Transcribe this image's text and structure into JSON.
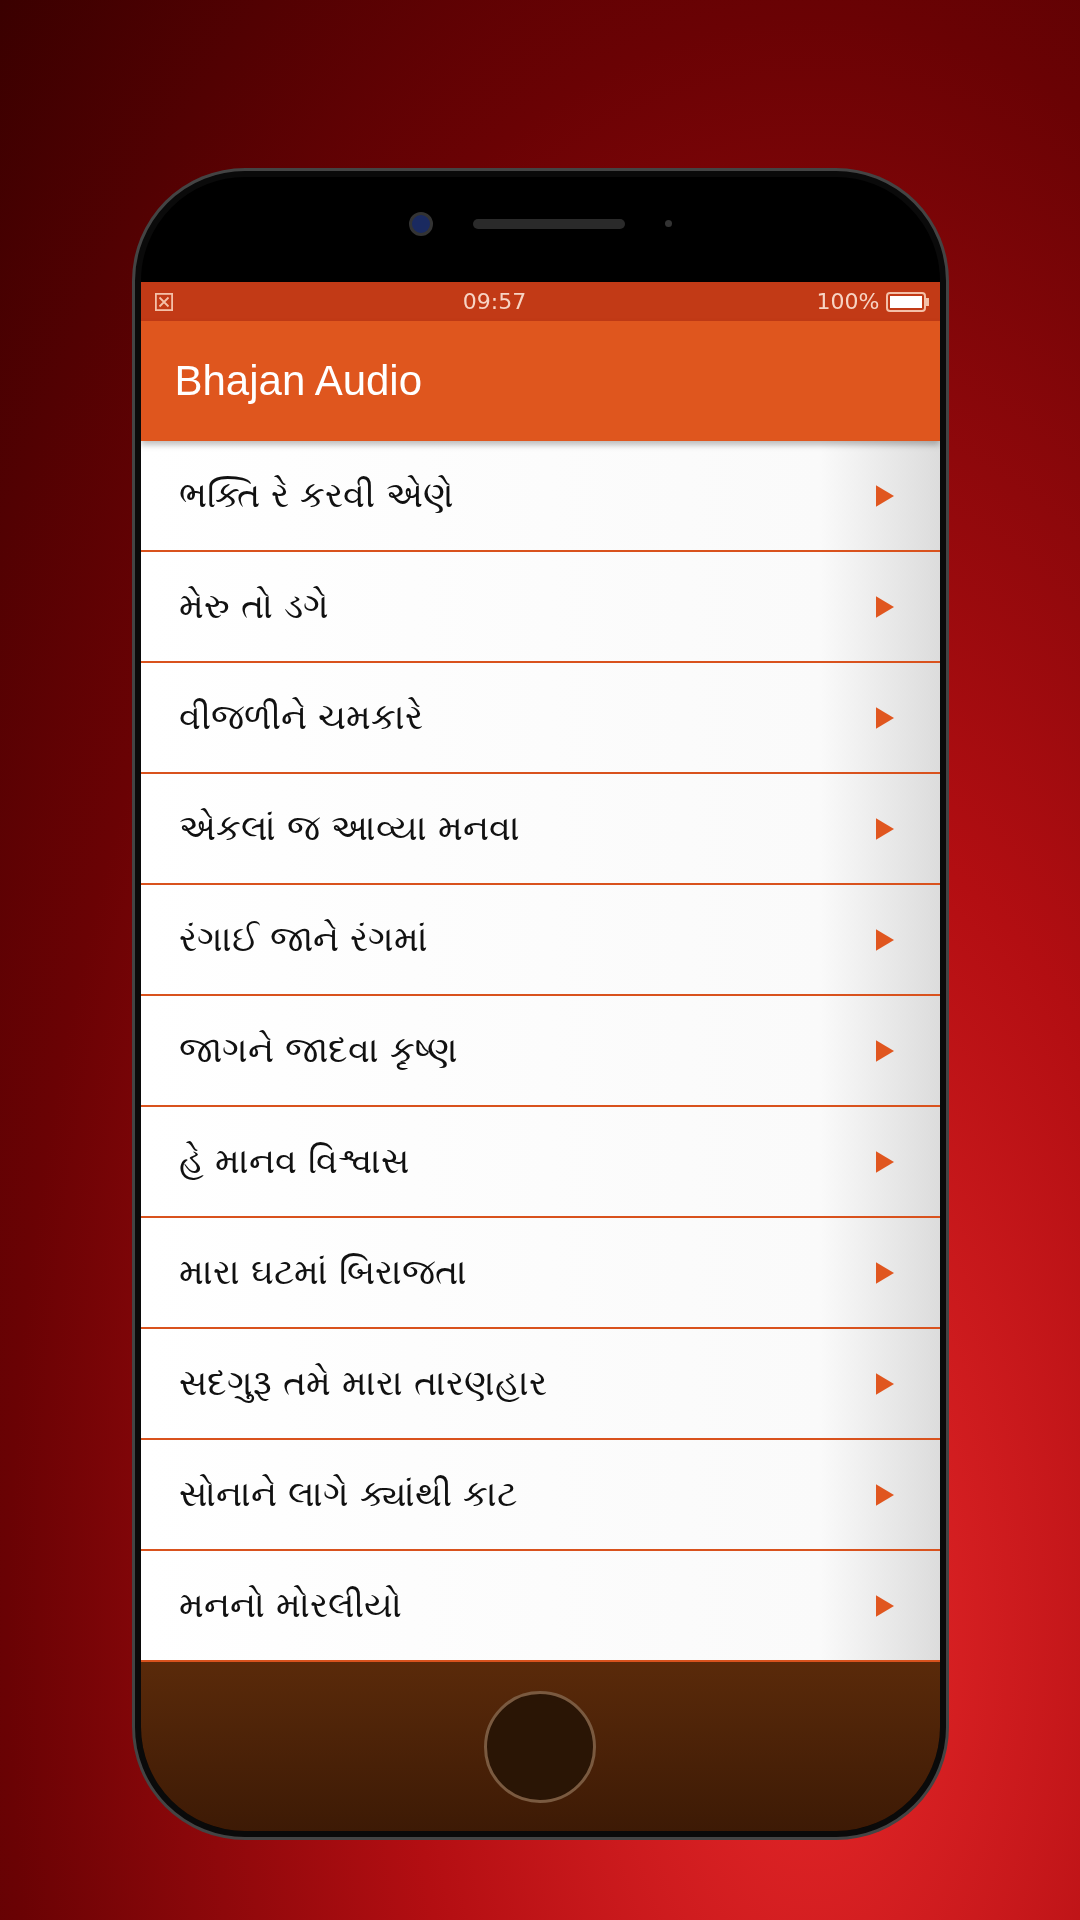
{
  "status_bar": {
    "time": "09:57",
    "battery": "100%"
  },
  "app_bar": {
    "title": "Bhajan Audio"
  },
  "items": [
    {
      "title": "ભક્તિ રે કરવી એણે"
    },
    {
      "title": "મેરુ તો ડગે"
    },
    {
      "title": "વીજળીને ચમકારે"
    },
    {
      "title": "એકલાં જ આવ્યા મનવા"
    },
    {
      "title": "રંગાઈ જાને રંગમાં"
    },
    {
      "title": "જાગને જાદવા કૃષ્ણ"
    },
    {
      "title": "હે માનવ વિશ્વાસ"
    },
    {
      "title": "મારા ઘટમાં બિરાજતા"
    },
    {
      "title": "સદગુરૂ તમે મારા તારણહાર"
    },
    {
      "title": "સોનાને લાગે ક્યાંથી કાટ"
    },
    {
      "title": "મનનો મોરલીયો"
    }
  ]
}
